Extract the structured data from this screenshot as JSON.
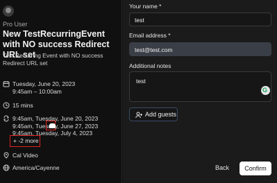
{
  "event": {
    "host": "Pro User",
    "title": "New TestRecurringEvent with NO success Redirect URL set",
    "description": "Test Recurring Event with NO success Redirect URL set",
    "date_line": "Tuesday, June 20, 2023",
    "time_line": "9:45am – 10:00am",
    "duration": "15 mins",
    "occurrences": [
      "9:45am, Tuesday, June 20, 2023",
      "9:45am, Tuesday, June 27, 2023",
      "9:45am, Tuesday, July 4, 2023"
    ],
    "more_label": "+ -2 more",
    "location": "Cal Video",
    "timezone": "America/Cayenne"
  },
  "form": {
    "name_label": "Your name *",
    "name_value": "test",
    "email_label": "Email address *",
    "email_value": "test@test.com",
    "notes_label": "Additional notes",
    "notes_value": "test",
    "add_guests_label": "Add guests"
  },
  "actions": {
    "back_label": "Back",
    "confirm_label": "Confirm"
  },
  "icons": {
    "calendar": "calendar-icon",
    "clock": "clock-icon",
    "repeat": "repeat-icon",
    "location": "location-icon",
    "globe": "globe-icon",
    "add_user": "user-plus-icon",
    "grammarly": "grammarly-icon"
  },
  "colors": {
    "highlight": "#e02020",
    "confirm_bg": "#ffffff"
  }
}
